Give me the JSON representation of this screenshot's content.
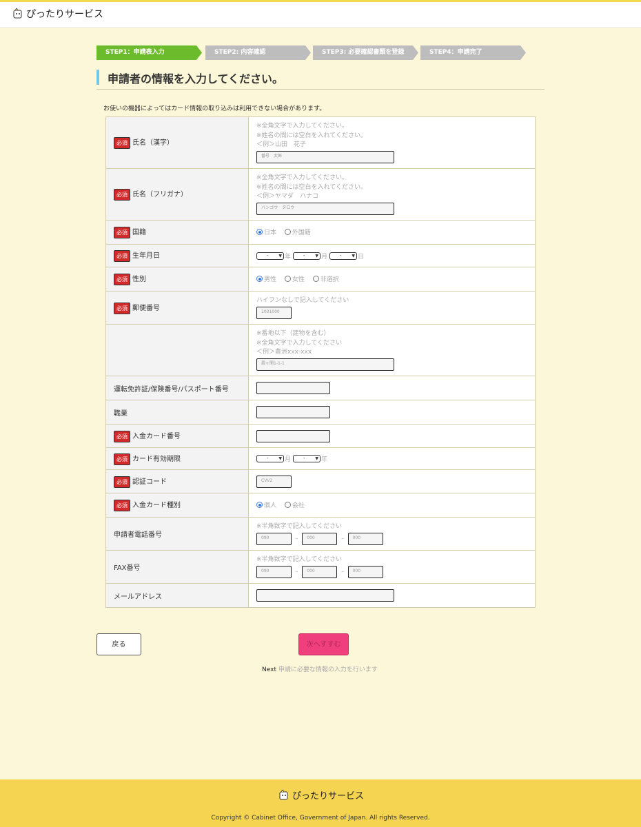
{
  "brand": {
    "name": "ぴったりサービス"
  },
  "steps": [
    {
      "label": "STEP1：申請表入力"
    },
    {
      "label": "STEP2: 内容確認"
    },
    {
      "label": "STEP3: 必要確認書類を登録"
    },
    {
      "label": "STEP4：申請完了"
    }
  ],
  "page": {
    "title": "申請者の情報を入力してください。",
    "notice": "お使いの機器によってはカード情報の取り込みは利用できない場合があります。"
  },
  "form": {
    "required_badge": "必須",
    "name_kanji": {
      "label": "氏名（漢字）",
      "hints": [
        "※全角文字で入力してください。",
        "※姓名の間には空白を入れてください。",
        "＜例＞山田　花子"
      ],
      "placeholder": "番号　太郎"
    },
    "name_kana": {
      "label": "氏名（フリガナ）",
      "hints": [
        "※全角文字で入力してください。",
        "※姓名の間には空白を入れてください。",
        "＜例＞ヤマダ　ハナコ"
      ],
      "placeholder": "バンゴウ　タロウ"
    },
    "nationality": {
      "label": "国籍",
      "options": [
        "日本",
        "外国籍"
      ],
      "selected": "日本"
    },
    "birthdate": {
      "label": "生年月日",
      "select_value": "-",
      "units": [
        "年",
        "月",
        "日"
      ]
    },
    "gender": {
      "label": "性別",
      "options": [
        "男性",
        "女性",
        "非選択"
      ],
      "selected": "男性"
    },
    "postal_code": {
      "label": "郵便番号",
      "hint": "ハイフンなしで記入してください",
      "placeholder": "1001000"
    },
    "address": {
      "hints": [
        "※番地以下（建物を含む）",
        "※全角文字で入力してください",
        "＜例＞豊洲xxx-xxx"
      ],
      "placeholder": "霞ヶ関1-1-1"
    },
    "id_number": {
      "label": "運転免許証/保険番号/パスポート番号"
    },
    "occupation": {
      "label": "職業"
    },
    "card_number": {
      "label": "入金カード番号"
    },
    "card_expiry": {
      "label": "カード有効期限",
      "select_value": "-",
      "units": [
        "月",
        "年"
      ]
    },
    "security_code": {
      "label": "認証コード",
      "placeholder": "CVV2"
    },
    "card_type": {
      "label": "入金カード種別",
      "options": [
        "個人",
        "会社"
      ],
      "selected": "個人"
    },
    "phone": {
      "label": "申請者電話番号",
      "hint": "※半角数字で記入してください",
      "placeholders": [
        "090",
        "000",
        "000"
      ],
      "separator": "-"
    },
    "fax": {
      "label": "FAX番号",
      "hint": "※半角数字で記入してください",
      "placeholders": [
        "090",
        "000",
        "000"
      ],
      "separator": "-"
    },
    "email": {
      "label": "メールアドレス"
    }
  },
  "actions": {
    "back_label": "戻る",
    "next_label": "次へすすむ",
    "next_title": "Next",
    "next_description": "申請に必要な情報の入力を行います"
  },
  "footer": {
    "brand": "ぴったりサービス",
    "copyright": "Copyright © Cabinet Office, Government of Japan. All rights Reserved."
  },
  "colors": {
    "accent_yellow": "#f5d451",
    "step_active": "#6bbb2c",
    "step_inactive": "#bdbdbd",
    "required": "#d22a2a",
    "next_button": "#ef3f7c",
    "background": "#fdf7d9"
  }
}
